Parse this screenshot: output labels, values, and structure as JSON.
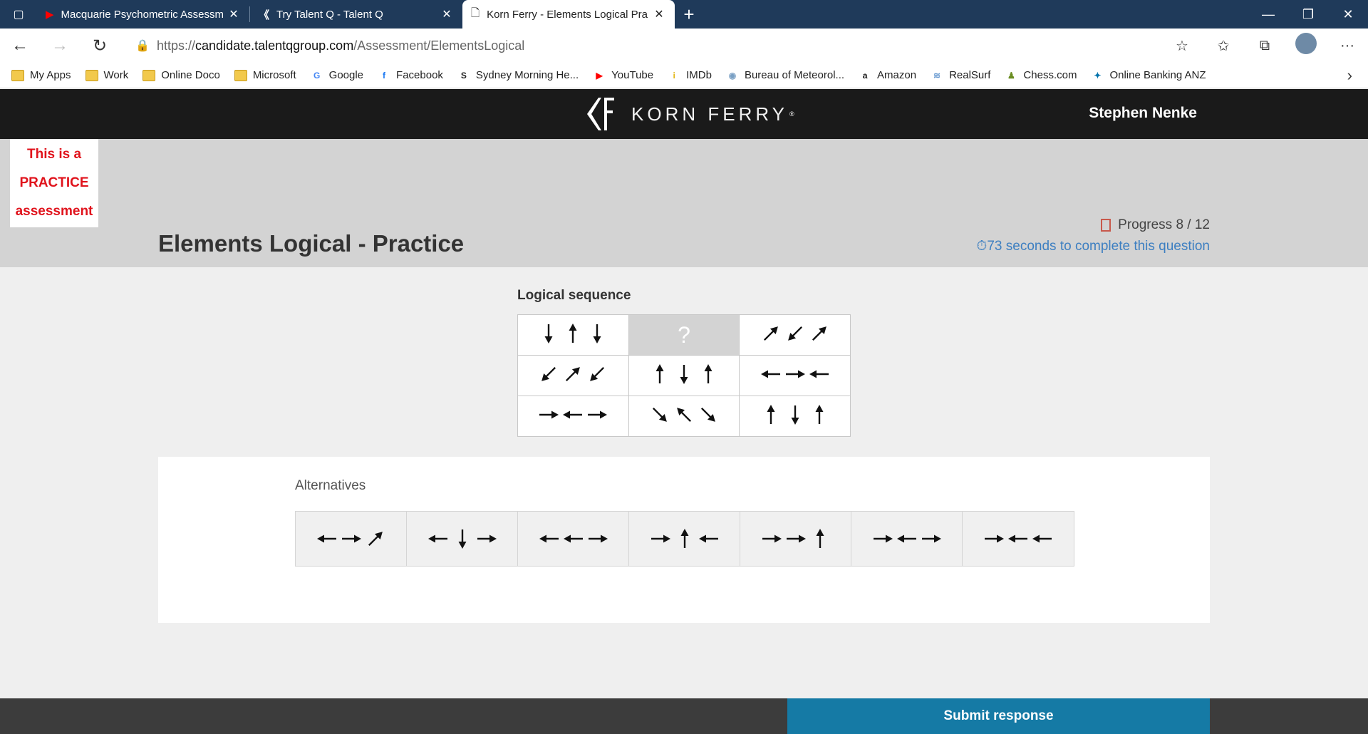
{
  "browser": {
    "tabs": [
      {
        "title": "Macquarie Psychometric Assessm",
        "icon": "youtube-icon",
        "active": false
      },
      {
        "title": "Try Talent Q - Talent Q",
        "icon": "kornferry-icon",
        "active": false
      },
      {
        "title": "Korn Ferry - Elements Logical Pra",
        "icon": "document-icon",
        "active": true
      }
    ],
    "url_prefix": "https://",
    "url_domain": "candidate.talentqgroup.com",
    "url_path": "/Assessment/ElementsLogical",
    "bookmarks": [
      {
        "label": "My Apps",
        "icon": "folder"
      },
      {
        "label": "Work",
        "icon": "folder"
      },
      {
        "label": "Online Doco",
        "icon": "folder"
      },
      {
        "label": "Microsoft",
        "icon": "folder"
      },
      {
        "label": "Google",
        "icon": "google"
      },
      {
        "label": "Facebook",
        "icon": "facebook"
      },
      {
        "label": "Sydney Morning He...",
        "icon": "smh"
      },
      {
        "label": "YouTube",
        "icon": "youtube"
      },
      {
        "label": "IMDb",
        "icon": "imdb"
      },
      {
        "label": "Bureau of Meteorol...",
        "icon": "bom"
      },
      {
        "label": "Amazon",
        "icon": "amazon"
      },
      {
        "label": "RealSurf",
        "icon": "realsurf"
      },
      {
        "label": "Chess.com",
        "icon": "chess"
      },
      {
        "label": "Online Banking  ANZ",
        "icon": "anz"
      }
    ]
  },
  "header": {
    "logo_text": "KORN FERRY",
    "logo_mark": "®",
    "user_name": "Stephen Nenke"
  },
  "practice_notice": {
    "line1": "This is a",
    "line2": "PRACTICE",
    "line3": "assessment"
  },
  "page_title": "Elements Logical - Practice",
  "progress": {
    "label": "Progress 8 / 12"
  },
  "timer": {
    "text": "73 seconds to complete this question"
  },
  "question": {
    "label": "Logical sequence",
    "unknown_symbol": "?",
    "grid": [
      [
        [
          "down",
          "up",
          "down"
        ],
        null,
        [
          "ne",
          "sw",
          "ne"
        ]
      ],
      [
        [
          "sw",
          "ne",
          "sw"
        ],
        [
          "up",
          "down",
          "up"
        ],
        [
          "left",
          "right",
          "left"
        ]
      ],
      [
        [
          "right",
          "left",
          "right"
        ],
        [
          "se",
          "nw",
          "se"
        ],
        [
          "up",
          "down",
          "up"
        ]
      ]
    ]
  },
  "alternatives": {
    "label": "Alternatives",
    "options": [
      [
        "left",
        "right",
        "ne"
      ],
      [
        "left",
        "down",
        "right"
      ],
      [
        "left",
        "left",
        "right"
      ],
      [
        "right",
        "up",
        "left"
      ],
      [
        "right",
        "right",
        "up"
      ],
      [
        "right",
        "left",
        "right"
      ],
      [
        "right",
        "left",
        "left"
      ]
    ]
  },
  "submit_label": "Submit response"
}
